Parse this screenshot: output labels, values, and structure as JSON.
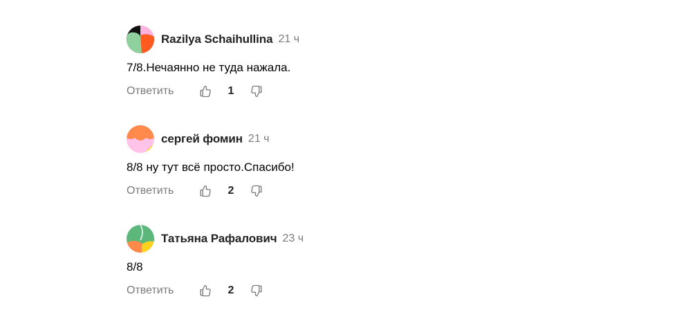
{
  "comments": [
    {
      "author": "Razilya Schaihullina",
      "time": "21 ч",
      "text": "7/8.Нечаянно не туда нажала.",
      "reply_label": "Ответить",
      "likes": "1",
      "avatar_icon": "avatar-abstract-black-pink-orange-green"
    },
    {
      "author": "сергей фомин",
      "time": "21 ч",
      "text": "8/8 ну тут всё просто.Спасибо!",
      "reply_label": "Ответить",
      "likes": "2",
      "avatar_icon": "avatar-abstract-orange-pink-yellow"
    },
    {
      "author": "Татьяна Рафалович",
      "time": "23 ч",
      "text": "8/8",
      "reply_label": "Ответить",
      "likes": "2",
      "avatar_icon": "avatar-abstract-green-orange-yellow"
    }
  ],
  "icons": {
    "like": "thumbs-up-icon",
    "dislike": "thumbs-down-icon"
  },
  "colors": {
    "muted_text": "#7a7a7a",
    "author_text": "#222222"
  }
}
